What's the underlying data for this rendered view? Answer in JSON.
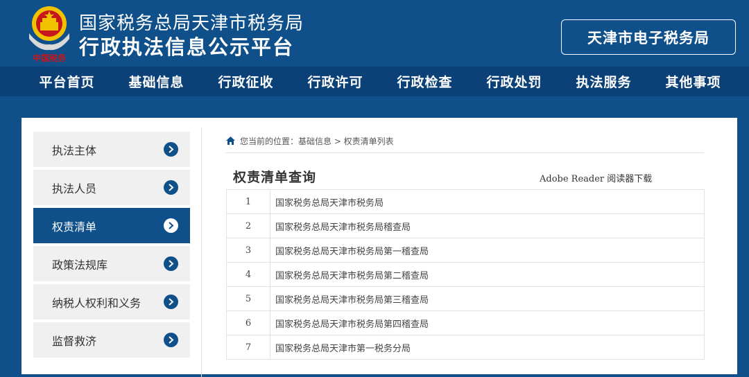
{
  "header": {
    "title_line1": "国家税务总局天津市税务局",
    "title_line2": "行政执法信息公示平台",
    "etax_label": "天津市电子税务局"
  },
  "nav": [
    {
      "label": "平台首页",
      "name": "nav-home"
    },
    {
      "label": "基础信息",
      "name": "nav-basic-info"
    },
    {
      "label": "行政征收",
      "name": "nav-collection"
    },
    {
      "label": "行政许可",
      "name": "nav-licensing"
    },
    {
      "label": "行政检查",
      "name": "nav-inspection"
    },
    {
      "label": "行政处罚",
      "name": "nav-penalty"
    },
    {
      "label": "执法服务",
      "name": "nav-service"
    },
    {
      "label": "其他事项",
      "name": "nav-other"
    }
  ],
  "sidebar": {
    "items": [
      {
        "label": "执法主体",
        "active": false
      },
      {
        "label": "执法人员",
        "active": false
      },
      {
        "label": "权责清单",
        "active": true
      },
      {
        "label": "政策法规库",
        "active": false
      },
      {
        "label": "纳税人权利和义务",
        "active": false
      },
      {
        "label": "监督救济",
        "active": false
      }
    ]
  },
  "breadcrumb": {
    "text": "您当前的位置：基础信息 > 权责清单列表"
  },
  "panel": {
    "title": "权责清单查询",
    "reader_link": "Adobe Reader 阅读器下载",
    "rows": [
      {
        "num": "1",
        "name": "国家税务总局天津市税务局"
      },
      {
        "num": "2",
        "name": "国家税务总局天津市税务局稽查局"
      },
      {
        "num": "3",
        "name": "国家税务总局天津市税务局第一稽查局"
      },
      {
        "num": "4",
        "name": "国家税务总局天津市税务局第二稽查局"
      },
      {
        "num": "5",
        "name": "国家税务总局天津市税务局第三稽查局"
      },
      {
        "num": "6",
        "name": "国家税务总局天津市税务局第四稽查局"
      },
      {
        "num": "7",
        "name": "国家税务总局天津市第一税务分局"
      }
    ]
  },
  "colors": {
    "brand_blue": "#0f4f8a",
    "nav_blue": "#0b4176",
    "emblem_red": "#c8161d",
    "emblem_gold": "#f2c200"
  },
  "icons": {
    "emblem": "tax-emblem-icon",
    "home": "home-icon",
    "arrow": "chevron-right-icon"
  }
}
